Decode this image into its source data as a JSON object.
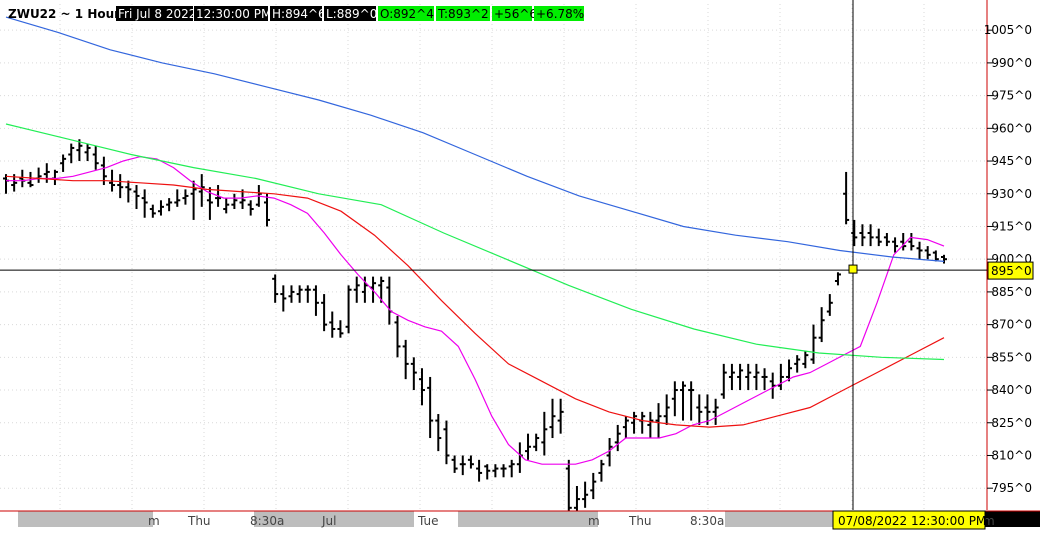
{
  "header": {
    "symbol_interval": "ZWU22 ~ 1 Hour",
    "datetime": "Fri Jul 8 2022",
    "time": "12:30:00 PM",
    "high": "H:894^6",
    "low": "L:889^0",
    "open": "O:892^4",
    "close": "T:893^2",
    "change": "+56^6",
    "change_pct": "+6.78%"
  },
  "crosshair": {
    "price_label": "895^0",
    "datetime_label": "07/08/2022 12:30:00 PM"
  },
  "time_axis_labels": [
    {
      "text": "m"
    },
    {
      "text": "Thu"
    },
    {
      "text": "8:30a"
    },
    {
      "text": "Jul"
    },
    {
      "text": "Tue"
    },
    {
      "text": "m"
    },
    {
      "text": "Thu"
    },
    {
      "text": "8:30a"
    },
    {
      "text": "m"
    }
  ],
  "colors": {
    "bars": "#000000",
    "ma_fast": "#ee00ee",
    "ma_mid": "#ee1111",
    "ma_slow": "#22ee55",
    "ma_long": "#3366dd",
    "axis_red": "#cc0000",
    "header_bg_dark": "#000000",
    "header_bg_green": "#00ee00",
    "crosshair_label_bg": "#ffff00",
    "timeaxis_gray": "#bdbdbd"
  },
  "chart_data": {
    "type": "ohlc",
    "title": "ZWU22 ~ 1 Hour",
    "y_ticks": [
      "795^0",
      "810^0",
      "825^0",
      "840^0",
      "855^0",
      "870^0",
      "885^0",
      "900^0",
      "915^0",
      "930^0",
      "945^0",
      "960^0",
      "975^0",
      "990^0",
      "1005^0"
    ],
    "y_tick_values": [
      795,
      810,
      825,
      840,
      855,
      870,
      885,
      900,
      915,
      930,
      945,
      960,
      975,
      990,
      1005
    ],
    "ylim": [
      785,
      1017
    ],
    "grid": true,
    "bar_highs": [
      939,
      939,
      941,
      940,
      942,
      944,
      941,
      948,
      953,
      955,
      953,
      952,
      947,
      941,
      939,
      936,
      934,
      932,
      925,
      927,
      928,
      932,
      932,
      936,
      939,
      933,
      934,
      928,
      930,
      932,
      927,
      934,
      930,
      893,
      888,
      888,
      888,
      888,
      888,
      884,
      876,
      872,
      888,
      892,
      892,
      892,
      892,
      892,
      874,
      863,
      855,
      850,
      846,
      829,
      826,
      810,
      810,
      810,
      808,
      806,
      806,
      806,
      808,
      816,
      820,
      820,
      830,
      836,
      836,
      808,
      796,
      798,
      802,
      808,
      818,
      824,
      828,
      830,
      830,
      830,
      834,
      838,
      844,
      844,
      844,
      838,
      838,
      836,
      852,
      852,
      852,
      852,
      852,
      850,
      848,
      852,
      854,
      856,
      858,
      870,
      878,
      884,
      894,
      940,
      918,
      916,
      916,
      914,
      912,
      910,
      912,
      912,
      908,
      906,
      904,
      902
    ],
    "bar_lows": [
      930,
      931,
      933,
      933,
      935,
      935,
      934,
      940,
      944,
      945,
      945,
      941,
      934,
      931,
      928,
      926,
      923,
      919,
      919,
      920,
      922,
      924,
      925,
      918,
      924,
      918,
      924,
      921,
      923,
      923,
      920,
      924,
      915,
      880,
      876,
      880,
      880,
      880,
      874,
      867,
      864,
      864,
      866,
      880,
      880,
      880,
      880,
      870,
      855,
      845,
      840,
      833,
      818,
      812,
      806,
      802,
      801,
      804,
      798,
      799,
      800,
      800,
      800,
      802,
      808,
      812,
      810,
      818,
      820,
      784,
      781,
      786,
      790,
      798,
      805,
      812,
      818,
      820,
      820,
      818,
      818,
      824,
      828,
      826,
      826,
      824,
      824,
      824,
      836,
      840,
      840,
      840,
      840,
      840,
      836,
      840,
      844,
      848,
      850,
      852,
      862,
      874,
      888,
      916,
      906,
      906,
      906,
      906,
      906,
      903,
      904,
      904,
      900,
      900,
      899,
      898
    ],
    "bar_opens": [
      937,
      934,
      937,
      935,
      937,
      939,
      937,
      944,
      948,
      950,
      949,
      948,
      943,
      935,
      934,
      933,
      931,
      928,
      923,
      922,
      925,
      926,
      928,
      930,
      931,
      927,
      928,
      923,
      925,
      926,
      925,
      925,
      926,
      891,
      884,
      883,
      884,
      886,
      886,
      880,
      871,
      868,
      869,
      886,
      885,
      887,
      888,
      887,
      871,
      860,
      852,
      845,
      841,
      826,
      822,
      808,
      806,
      808,
      804,
      805,
      803,
      804,
      805,
      806,
      812,
      814,
      816,
      823,
      826,
      804,
      786,
      790,
      794,
      802,
      810,
      816,
      823,
      825,
      826,
      824,
      826,
      828,
      836,
      840,
      840,
      832,
      832,
      830,
      838,
      846,
      846,
      846,
      846,
      846,
      844,
      842,
      846,
      852,
      852,
      854,
      864,
      876,
      890,
      930,
      912,
      912,
      912,
      910,
      910,
      908,
      908,
      908,
      905,
      904,
      903,
      901
    ],
    "bar_closes": [
      936,
      935,
      936,
      934,
      938,
      940,
      940,
      946,
      951,
      952,
      951,
      944,
      938,
      934,
      933,
      932,
      929,
      926,
      921,
      924,
      926,
      927,
      929,
      932,
      933,
      926,
      928,
      925,
      927,
      927,
      923,
      930,
      918,
      884,
      882,
      885,
      886,
      886,
      880,
      870,
      868,
      866,
      886,
      888,
      888,
      889,
      890,
      876,
      860,
      852,
      848,
      840,
      826,
      818,
      810,
      804,
      806,
      806,
      802,
      803,
      804,
      804,
      806,
      810,
      814,
      818,
      822,
      828,
      830,
      786,
      790,
      792,
      798,
      806,
      814,
      820,
      826,
      828,
      828,
      826,
      828,
      832,
      840,
      842,
      840,
      830,
      830,
      832,
      848,
      848,
      849,
      848,
      848,
      846,
      842,
      846,
      850,
      854,
      856,
      864,
      872,
      880,
      893,
      918,
      910,
      910,
      910,
      908,
      908,
      906,
      906,
      906,
      904,
      902,
      900,
      900
    ],
    "series": [
      {
        "name": "",
        "color": "#ee00ee",
        "values": [
          936,
          936,
          937,
          937,
          938,
          940,
          942,
          945,
          947,
          946,
          942,
          936,
          931,
          928,
          928,
          929,
          928,
          925,
          921,
          912,
          902,
          893,
          885,
          876,
          872,
          869,
          867,
          860,
          845,
          828,
          815,
          808,
          806,
          806,
          806,
          808,
          812,
          818,
          818,
          818,
          820,
          824,
          826,
          830,
          834,
          838,
          842,
          846,
          848,
          852,
          856,
          860,
          880,
          902,
          910,
          909,
          906
        ]
      },
      {
        "name": "",
        "color": "#ee1111",
        "values": [
          938,
          937,
          936,
          936,
          935,
          934,
          932,
          931,
          930,
          928,
          922,
          911,
          897,
          881,
          866,
          852,
          844,
          836,
          830,
          826,
          824,
          823,
          824,
          828,
          832,
          840,
          848,
          856,
          864
        ]
      },
      {
        "name": "",
        "color": "#22ee55",
        "values": [
          962,
          955,
          948,
          942,
          937,
          930,
          925,
          912,
          900,
          888,
          877,
          868,
          861,
          857,
          855,
          854
        ]
      },
      {
        "name": "",
        "color": "#3366dd",
        "values": [
          1011,
          1004,
          996,
          990,
          985,
          979,
          973,
          966,
          958,
          948,
          938,
          929,
          922,
          915,
          911,
          908,
          904,
          901,
          899
        ]
      }
    ]
  }
}
